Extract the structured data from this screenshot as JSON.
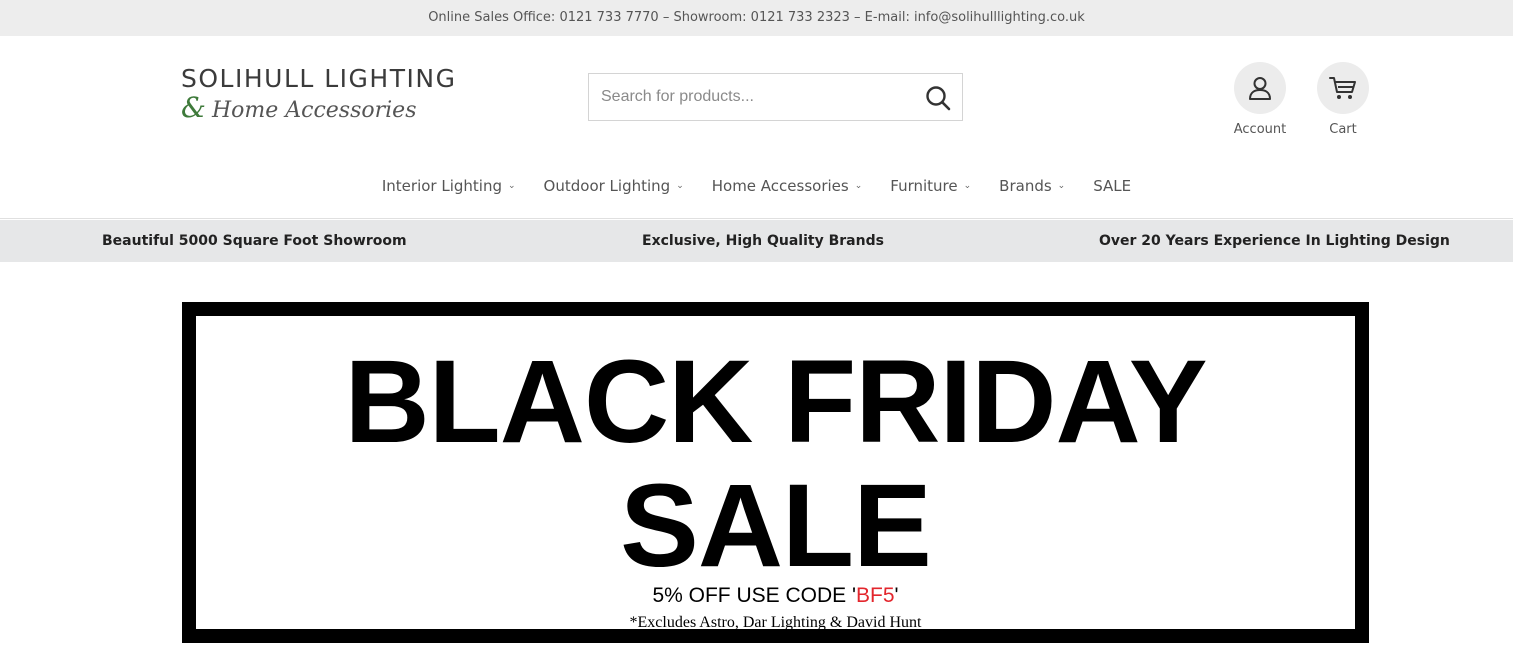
{
  "topbar": {
    "contact": "Online Sales Office: 0121 733 7770 – Showroom: 0121 733 2323 – E-mail: info@solihulllighting.co.uk"
  },
  "logo": {
    "line1": "SOLIHULL LIGHTING",
    "amp": "&",
    "line2": "Home Accessories"
  },
  "search": {
    "placeholder": "Search for products..."
  },
  "account": {
    "label": "Account"
  },
  "cart": {
    "label": "Cart"
  },
  "nav": {
    "items": [
      {
        "label": "Interior Lighting"
      },
      {
        "label": "Outdoor Lighting"
      },
      {
        "label": "Home Accessories"
      },
      {
        "label": "Furniture"
      },
      {
        "label": "Brands"
      },
      {
        "label": "SALE"
      }
    ]
  },
  "usp": {
    "item1": "Beautiful 5000 Square Foot Showroom",
    "item2": "Exclusive, High Quality Brands",
    "item3": "Over 20 Years Experience In Lighting Design"
  },
  "banner": {
    "title_line1": "BLACK FRIDAY",
    "title_line2": "SALE",
    "code_prefix": "5% OFF USE CODE '",
    "code": "BF5",
    "code_suffix": "'",
    "note": "*Excludes Astro, Dar Lighting & David Hunt"
  },
  "colors": {
    "topbar_bg": "#ededed",
    "usp_bg": "#e6e7e8",
    "logo_green": "#3e7a3a",
    "code_red": "#e3262d"
  }
}
